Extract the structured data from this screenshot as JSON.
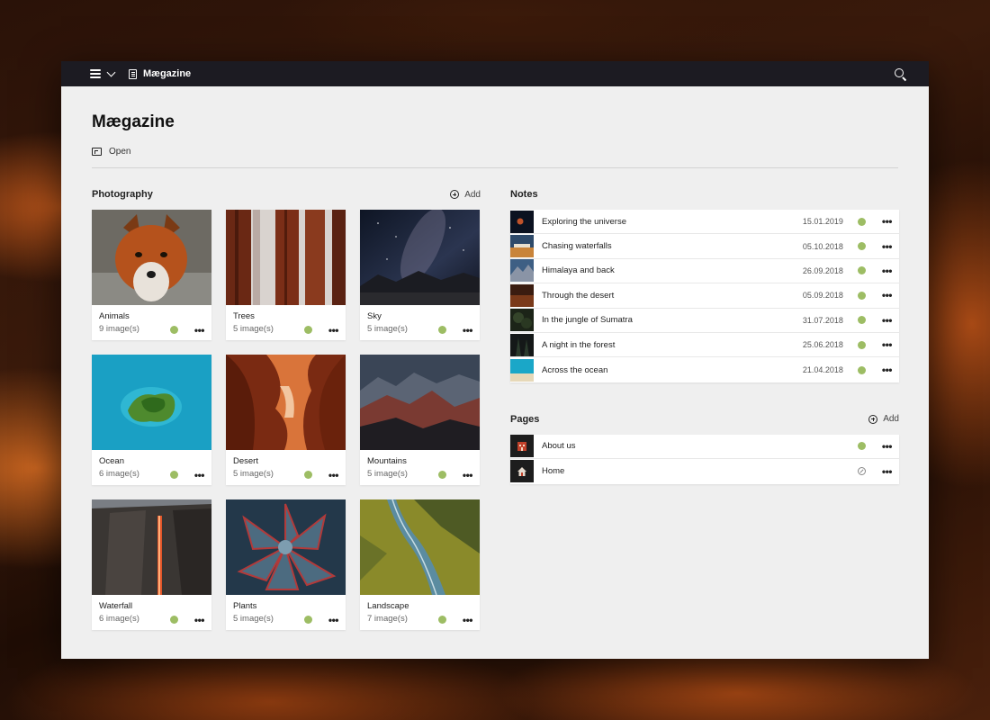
{
  "topbar": {
    "app_name": "Mægazine"
  },
  "page": {
    "title": "Mægazine",
    "open_label": "Open"
  },
  "photography": {
    "title": "Photography",
    "add_label": "Add",
    "albums": [
      {
        "name": "Animals",
        "count": "9 image(s)"
      },
      {
        "name": "Trees",
        "count": "5 image(s)"
      },
      {
        "name": "Sky",
        "count": "5 image(s)"
      },
      {
        "name": "Ocean",
        "count": "6 image(s)"
      },
      {
        "name": "Desert",
        "count": "5 image(s)"
      },
      {
        "name": "Mountains",
        "count": "5 image(s)"
      },
      {
        "name": "Waterfall",
        "count": "6 image(s)"
      },
      {
        "name": "Plants",
        "count": "5 image(s)"
      },
      {
        "name": "Landscape",
        "count": "7 image(s)"
      }
    ]
  },
  "notes": {
    "title": "Notes",
    "items": [
      {
        "title": "Exploring the universe",
        "date": "15.01.2019"
      },
      {
        "title": "Chasing waterfalls",
        "date": "05.10.2018"
      },
      {
        "title": "Himalaya and back",
        "date": "26.09.2018"
      },
      {
        "title": "Through the desert",
        "date": "05.09.2018"
      },
      {
        "title": "In the jungle of Sumatra",
        "date": "31.07.2018"
      },
      {
        "title": "A night in the forest",
        "date": "25.06.2018"
      },
      {
        "title": "Across the ocean",
        "date": "21.04.2018"
      }
    ]
  },
  "pages": {
    "title": "Pages",
    "add_label": "Add",
    "items": [
      {
        "title": "About us",
        "status": "published"
      },
      {
        "title": "Home",
        "status": "unpublished"
      }
    ]
  },
  "colors": {
    "status_published": "#9dbd64",
    "topbar": "#1c1b22"
  }
}
